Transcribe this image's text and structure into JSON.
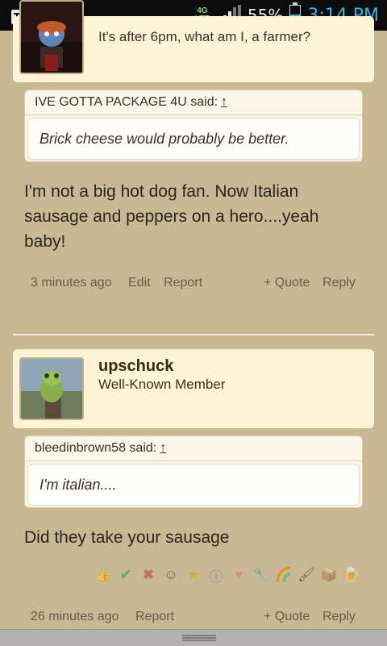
{
  "statusbar": {
    "network": "4G LTE",
    "battery": "55%",
    "battery_level": 0.55,
    "time": "3:14 PM"
  },
  "post1": {
    "user_message": "It's after 6pm, what am I, a farmer?",
    "quote_author": "IVE GOTTA PACKAGE 4U said:",
    "quote_arrow": "↑",
    "quote_text": "Brick cheese would probably be better.",
    "text": "I'm not a big hot dog fan. Now Italian sausage and peppers on a hero....yeah baby!",
    "time": "3 minutes ago",
    "edit": "Edit",
    "report": "Report",
    "quote_btn": "+ Quote",
    "reply": "Reply"
  },
  "post2": {
    "username": "upschuck",
    "role": "Well-Known Member",
    "quote_author": "bleedinbrown58 said:",
    "quote_arrow": "↑",
    "quote_text": "I'm italian....",
    "text": "Did they take your sausage",
    "time": "26 minutes ago",
    "report": "Report",
    "quote_btn": "+ Quote",
    "reply": "Reply"
  },
  "reactions": [
    "like-icon",
    "agree-icon",
    "disagree-icon",
    "funny-icon",
    "winner-icon",
    "informative-icon",
    "love-icon",
    "useful-icon",
    "rainbow-icon",
    "creative-icon",
    "package-icon",
    "beer-icon"
  ]
}
